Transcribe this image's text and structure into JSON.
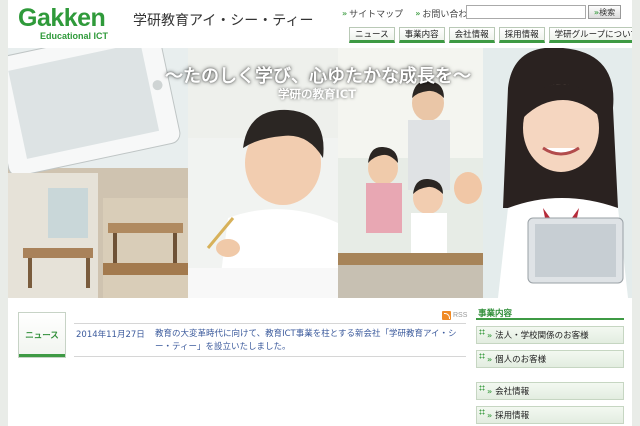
{
  "header": {
    "logo_word": "Gakken",
    "logo_sub": "Educational ICT",
    "company_name": "学研教育アイ・シー・ティー",
    "util_links": [
      "サイトマップ",
      "お問い合わせ"
    ],
    "search_placeholder": "",
    "search_button": "検索"
  },
  "nav": {
    "tabs": [
      "ニュース",
      "事業内容",
      "会社情報",
      "採用情報",
      "学研グループについて"
    ]
  },
  "hero": {
    "title": "〜たのしく学び、心ゆたかな成長を〜",
    "subtitle": "学研の教育ICT"
  },
  "news": {
    "label": "ニュース",
    "rss": "RSS",
    "items": [
      {
        "date": "2014年11月27日",
        "text": "教育の大変革時代に向けて、教育ICT事業を柱とする新会社「学研教育アイ・シー・ティー」を設立いたしました。"
      }
    ]
  },
  "sidebar": {
    "section_title": "事業内容",
    "section_items": [
      "法人・学校関係のお客様",
      "個人のお客様"
    ],
    "section_title_2": "事業内容",
    "links": [
      "会社情報",
      "採用情報"
    ]
  },
  "colors": {
    "brand_green": "#2f9a3a",
    "accent_green": "#3e9a44",
    "link_blue": "#3b5a9c"
  }
}
